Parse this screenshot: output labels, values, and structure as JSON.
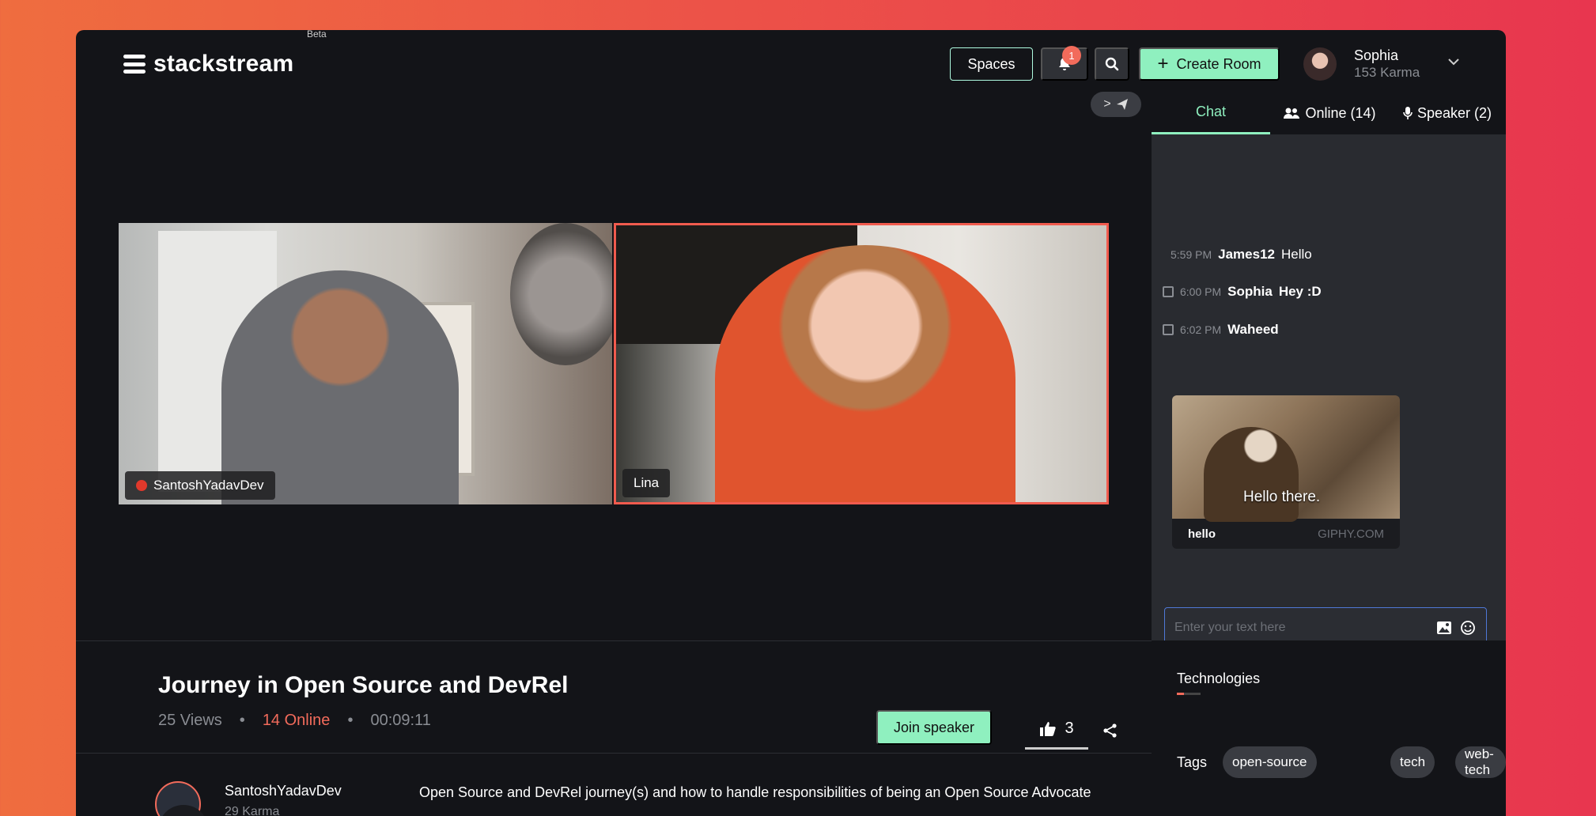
{
  "app": {
    "logo_text": "stackstream",
    "beta_label": "Beta"
  },
  "header": {
    "spaces_label": "Spaces",
    "notification_count": "1",
    "create_room_label": "Create Room",
    "user_name": "Sophia",
    "user_karma": "153 Karma"
  },
  "chat": {
    "tabs": [
      {
        "label": "Chat",
        "icon": "none"
      },
      {
        "label": "Online (14)",
        "icon": "users-icon"
      },
      {
        "label": "Speaker (2)",
        "icon": "mic-icon"
      }
    ],
    "messages": [
      {
        "time": "5:59 PM",
        "name": "James12",
        "text": "Hello"
      },
      {
        "time": "6:00 PM",
        "name": "Sophia",
        "text": "Hey :D"
      },
      {
        "time": "6:02 PM",
        "name": "Waheed",
        "text": ""
      }
    ],
    "gif": {
      "caption": "Hello there.",
      "label": "hello",
      "source": "GIPHY.COM"
    },
    "input_placeholder": "Enter your text here"
  },
  "videos": [
    {
      "name": "SantoshYadavDev",
      "recording": true
    },
    {
      "name": "Lina",
      "recording": false
    }
  ],
  "room": {
    "title": "Journey in Open Source and DevRel",
    "views": "25 Views",
    "online": "14 Online",
    "duration": "00:09:11",
    "join_label": "Join speaker",
    "likes": "3"
  },
  "host": {
    "name": "SantoshYadavDev",
    "karma": "29 Karma",
    "description": "Open Source and DevRel journey(s) and how to handle responsibilities of being an Open Source Advocate"
  },
  "sidebar_bottom": {
    "technologies_label": "Technologies",
    "tags_label": "Tags",
    "tags": [
      "open-source",
      "tech",
      "web-tech"
    ]
  },
  "colors": {
    "accent_green": "#8ff0bf",
    "accent_red": "#f26b5b",
    "background": "#131418"
  }
}
